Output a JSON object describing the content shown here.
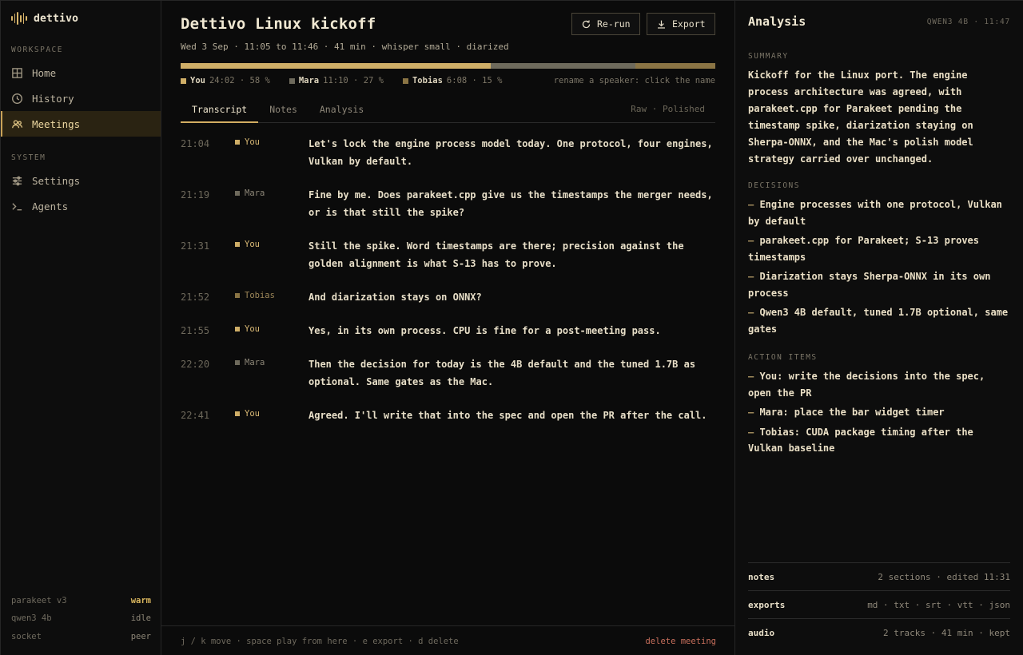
{
  "app": {
    "name": "dettivo"
  },
  "sidebar": {
    "workspace_label": "WORKSPACE",
    "system_label": "SYSTEM",
    "workspace_items": [
      {
        "label": "Home",
        "icon": "grid-icon"
      },
      {
        "label": "History",
        "icon": "clock-icon"
      },
      {
        "label": "Meetings",
        "icon": "people-icon",
        "active": true
      }
    ],
    "system_items": [
      {
        "label": "Settings",
        "icon": "sliders-icon"
      },
      {
        "label": "Agents",
        "icon": "terminal-icon"
      }
    ],
    "status": [
      {
        "name": "parakeet v3",
        "value": "warm"
      },
      {
        "name": "qwen3 4b",
        "value": "idle"
      },
      {
        "name": "socket",
        "value": "peer"
      }
    ]
  },
  "meeting": {
    "title": "Dettivo Linux kickoff",
    "meta": "Wed 3 Sep · 11:05 to 11:46 · 41 min · whisper small · diarized",
    "rerun_label": "Re-run",
    "export_label": "Export",
    "speaker_share": [
      {
        "name": "You",
        "time": "24:02",
        "percent": 58,
        "color": "#cfae67"
      },
      {
        "name": "Mara",
        "time": "11:10",
        "percent": 27,
        "color": "#6e6a5c"
      },
      {
        "name": "Tobias",
        "time": "6:08",
        "percent": 15,
        "color": "#8a7444"
      }
    ],
    "rename_hint": "rename a speaker: click the name"
  },
  "tabs": [
    {
      "label": "Transcript",
      "active": true
    },
    {
      "label": "Notes"
    },
    {
      "label": "Analysis"
    }
  ],
  "view_toggle": {
    "raw": "Raw",
    "sep": " · ",
    "polished": "Polished"
  },
  "transcript": [
    {
      "time": "21:04",
      "speaker": "You",
      "text": "Let's lock the engine process model today. One protocol, four engines, Vulkan by default."
    },
    {
      "time": "21:19",
      "speaker": "Mara",
      "text": "Fine by me. Does parakeet.cpp give us the timestamps the merger needs, or is that still the spike?"
    },
    {
      "time": "21:31",
      "speaker": "You",
      "text": "Still the spike. Word timestamps are there; precision against the golden alignment is what S-13 has to prove."
    },
    {
      "time": "21:52",
      "speaker": "Tobias",
      "text": "And diarization stays on ONNX?"
    },
    {
      "time": "21:55",
      "speaker": "You",
      "text": "Yes, in its own process. CPU is fine for a post-meeting pass."
    },
    {
      "time": "22:20",
      "speaker": "Mara",
      "text": "Then the decision for today is the 4B default and the tuned 1.7B as optional. Same gates as the Mac."
    },
    {
      "time": "22:41",
      "speaker": "You",
      "text": "Agreed. I'll write that into the spec and open the PR after the call."
    }
  ],
  "footer": {
    "hints": "j / k move · space play from here · e export · d delete",
    "delete_label": "delete meeting"
  },
  "analysis": {
    "title": "Analysis",
    "model": "QWEN3 4B · 11:47",
    "summary_label": "SUMMARY",
    "summary": "Kickoff for the Linux port. The engine process architecture was agreed, with parakeet.cpp for Parakeet pending the timestamp spike, diarization staying on Sherpa-ONNX, and the Mac's polish model strategy carried over unchanged.",
    "decisions_label": "DECISIONS",
    "decisions": [
      "Engine processes with one protocol, Vulkan by default",
      "parakeet.cpp for Parakeet; S-13 proves timestamps",
      "Diarization stays Sherpa-ONNX in its own process",
      "Qwen3 4B default, tuned 1.7B optional, same gates"
    ],
    "actions_label": "ACTION ITEMS",
    "actions": [
      "You: write the decisions into the spec, open the PR",
      "Mara: place the bar widget timer",
      "Tobias: CUDA package timing after the Vulkan baseline"
    ],
    "rows": [
      {
        "key": "notes",
        "value": "2 sections · edited 11:31"
      },
      {
        "key": "exports",
        "value": "md · txt · srt · vtt · json"
      },
      {
        "key": "audio",
        "value": "2 tracks · 41 min · kept"
      }
    ]
  },
  "colors": {
    "accent": "#d2ad62",
    "you": "#cfae67",
    "mara": "#6e6a5c",
    "tobias": "#8a7444",
    "danger": "#c86f5c"
  }
}
